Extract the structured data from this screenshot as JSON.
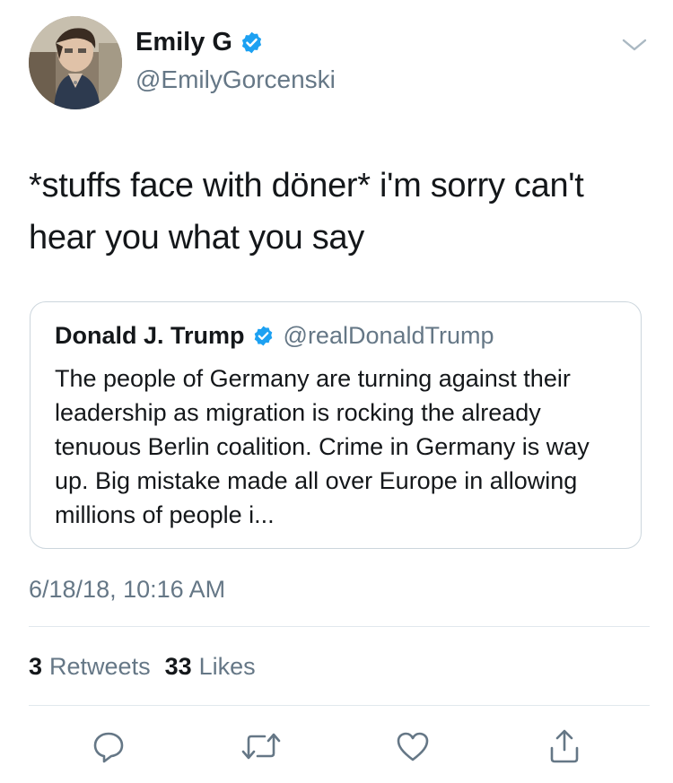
{
  "author": {
    "display_name": "Emily G",
    "handle": "@EmilyGorcenski",
    "verified": true,
    "avatar_icon": "avatar-photo"
  },
  "tweet": {
    "text": "*stuffs face with döner* i'm sorry can't hear you what you say",
    "timestamp": "6/18/18, 10:16 AM"
  },
  "quoted_tweet": {
    "display_name": "Donald J. Trump",
    "handle": "@realDonaldTrump",
    "verified": true,
    "text": "The people of Germany are turning against their leadership as migration is rocking the already tenuous Berlin coalition. Crime in Germany is way up. Big mistake made all over Europe in allowing millions of people i..."
  },
  "stats": {
    "retweets_count": "3",
    "retweets_label": "Retweets",
    "likes_count": "33",
    "likes_label": "Likes"
  },
  "actions": {
    "reply_icon": "reply-icon",
    "retweet_icon": "retweet-icon",
    "like_icon": "heart-icon",
    "share_icon": "share-icon"
  },
  "colors": {
    "primary_text": "#14171a",
    "secondary_text": "#657786",
    "verified_blue": "#1da1f2",
    "border": "#ccd6dd",
    "divider": "#e1e8ed"
  }
}
